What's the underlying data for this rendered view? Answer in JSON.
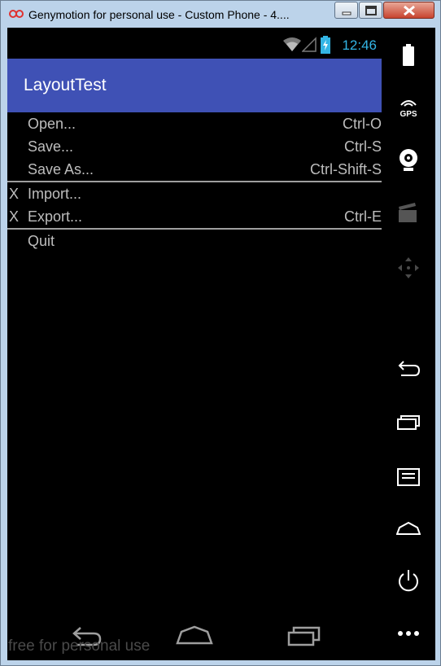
{
  "window": {
    "title": "Genymotion for personal use - Custom Phone - 4...."
  },
  "status_bar": {
    "time": "12:46",
    "accent_color": "#33b5e5"
  },
  "app_bar": {
    "title": "LayoutTest",
    "color": "#3f51b5"
  },
  "menu": {
    "items": [
      {
        "mark": "",
        "label": "Open...",
        "shortcut": "Ctrl-O"
      },
      {
        "mark": "",
        "label": "Save...",
        "shortcut": "Ctrl-S"
      },
      {
        "mark": "",
        "label": "Save As...",
        "shortcut": "Ctrl-Shift-S"
      },
      {
        "mark": "X",
        "label": "Import...",
        "shortcut": ""
      },
      {
        "mark": "X",
        "label": "Export...",
        "shortcut": "Ctrl-E"
      },
      {
        "mark": "",
        "label": "Quit",
        "shortcut": ""
      }
    ]
  },
  "sidebar": {
    "gps_label": "GPS",
    "icons": [
      "battery-icon",
      "gps-icon",
      "webcam-icon",
      "media-icon",
      "dpad-icon",
      "back-icon",
      "recent-apps-icon",
      "menu-icon",
      "home-icon",
      "power-icon",
      "more-icon"
    ]
  },
  "navigation": {
    "icons": [
      "back-icon",
      "home-icon",
      "recent-apps-icon"
    ]
  },
  "watermark": "free for personal use"
}
